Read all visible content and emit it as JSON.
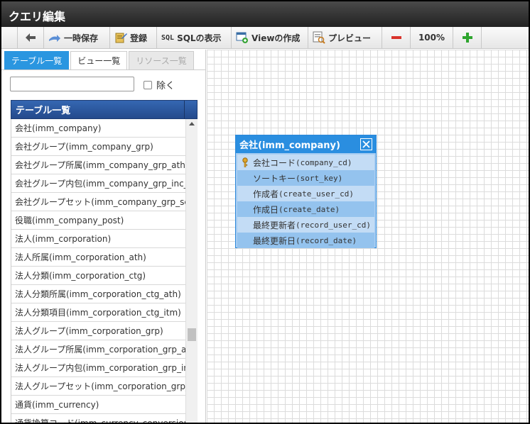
{
  "window": {
    "title": "クエリ編集"
  },
  "toolbar": {
    "save_label": "一時保存",
    "register_label": "登録",
    "sql_icon_text": "SQL",
    "sql_label": "SQLの表示",
    "view_create_label": "Viewの作成",
    "preview_label": "プレビュー",
    "zoom_level": "100%",
    "icons": {
      "back": "arrow-left-icon",
      "save": "save-icon",
      "register": "register-icon",
      "sql": "sql-icon",
      "view": "view-create-icon",
      "preview": "preview-icon",
      "zoom_out": "minus-icon",
      "zoom_in": "plus-icon"
    }
  },
  "tabs": [
    {
      "label": "テーブル一覧",
      "state": "active"
    },
    {
      "label": "ビュー一覧",
      "state": "normal"
    },
    {
      "label": "リソース一覧",
      "state": "disabled"
    }
  ],
  "filter": {
    "value": "",
    "placeholder": "",
    "exclude_label": "除く",
    "exclude_checked": false
  },
  "table_list": {
    "header": "テーブル一覧",
    "rows": [
      "会社(imm_company)",
      "会社グループ(imm_company_grp)",
      "会社グループ所属(imm_company_grp_ath)",
      "会社グループ内包(imm_company_grp_inc_a",
      "会社グループセット(imm_company_grp_set",
      "役職(imm_company_post)",
      "法人(imm_corporation)",
      "法人所属(imm_corporation_ath)",
      "法人分類(imm_corporation_ctg)",
      "法人分類所属(imm_corporation_ctg_ath)",
      "法人分類項目(imm_corporation_ctg_itm)",
      "法人グループ(imm_corporation_grp)",
      "法人グループ所属(imm_corporation_grp_ath",
      "法人グループ内包(imm_corporation_grp_inc_",
      "法人グループセット(imm_corporation_grp_s",
      "通貨(imm_currency)",
      "通貨換算コード(imm_currency_conversion)"
    ]
  },
  "entity": {
    "title": "会社(imm_company)",
    "columns": [
      {
        "label": "会社コード",
        "code": "(company_cd)",
        "primary_key": true
      },
      {
        "label": "ソートキー",
        "code": "(sort_key)",
        "primary_key": false
      },
      {
        "label": "作成者",
        "code": "(create_user_cd)",
        "primary_key": false
      },
      {
        "label": "作成日",
        "code": "(create_date)",
        "primary_key": false
      },
      {
        "label": "最終更新者",
        "code": "(record_user_cd)",
        "primary_key": false
      },
      {
        "label": "最終更新日",
        "code": "(record_date)",
        "primary_key": false
      }
    ]
  },
  "colors": {
    "accent": "#2a96e0",
    "header_blue": "#3567b2",
    "entity_header": "#2a8ee0",
    "zoom_out": "#d9332b",
    "zoom_in": "#2ea52e"
  }
}
